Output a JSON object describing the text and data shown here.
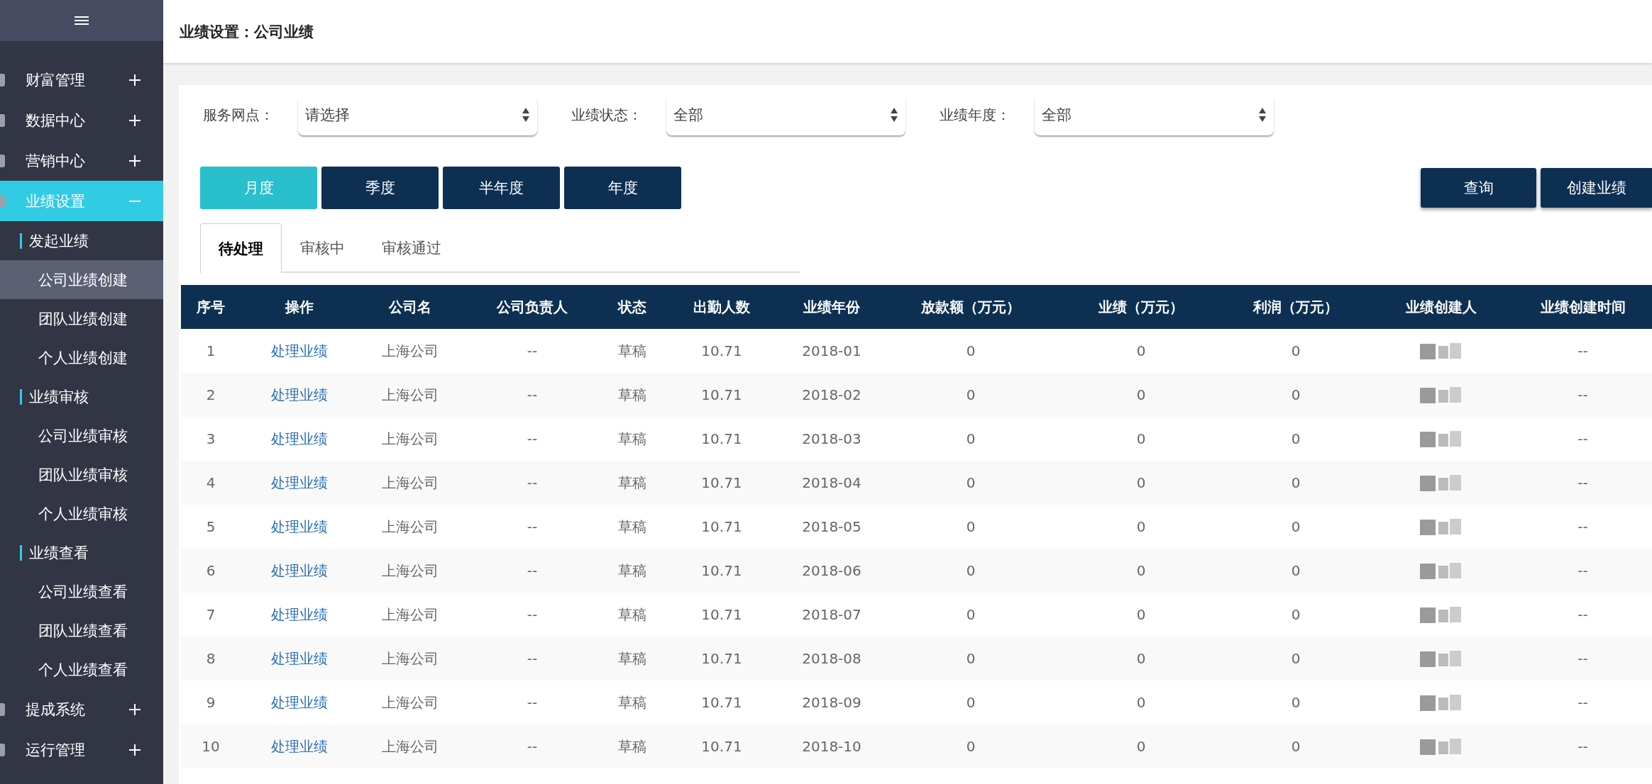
{
  "sidebar": {
    "menu": [
      {
        "label": "财富管理",
        "expanded": false,
        "selected": false
      },
      {
        "label": "数据中心",
        "expanded": false,
        "selected": false
      },
      {
        "label": "营销中心",
        "expanded": false,
        "selected": false
      },
      {
        "label": "业绩设置",
        "expanded": true,
        "selected": true,
        "children": [
          {
            "label": "发起业绩",
            "children": [
              {
                "label": "公司业绩创建",
                "selected": true
              },
              {
                "label": "团队业绩创建",
                "selected": false
              },
              {
                "label": "个人业绩创建",
                "selected": false
              }
            ]
          },
          {
            "label": "业绩审核",
            "children": [
              {
                "label": "公司业绩审核",
                "selected": false
              },
              {
                "label": "团队业绩审核",
                "selected": false
              },
              {
                "label": "个人业绩审核",
                "selected": false
              }
            ]
          },
          {
            "label": "业绩查看",
            "children": [
              {
                "label": "公司业绩查看",
                "selected": false
              },
              {
                "label": "团队业绩查看",
                "selected": false
              },
              {
                "label": "个人业绩查看",
                "selected": false
              }
            ]
          }
        ]
      },
      {
        "label": "提成系统",
        "expanded": false,
        "selected": false
      },
      {
        "label": "运行管理",
        "expanded": false,
        "selected": false
      }
    ]
  },
  "page_title": "业绩设置：公司业绩",
  "filters": [
    {
      "label": "服务网点：",
      "value": "请选择"
    },
    {
      "label": "业绩状态：",
      "value": "全部"
    },
    {
      "label": "业绩年度：",
      "value": "全部"
    }
  ],
  "periods": [
    {
      "label": "月度",
      "selected": true
    },
    {
      "label": "季度",
      "selected": false
    },
    {
      "label": "半年度",
      "selected": false
    },
    {
      "label": "年度",
      "selected": false
    }
  ],
  "actions": [
    "查询",
    "创建业绩"
  ],
  "tabs": [
    {
      "label": "待处理",
      "selected": true
    },
    {
      "label": "审核中",
      "selected": false
    },
    {
      "label": "审核通过",
      "selected": false
    }
  ],
  "table": {
    "columns": [
      "序号",
      "操作",
      "公司名",
      "公司负责人",
      "状态",
      "出勤人数",
      "业绩年份",
      "放款额（万元）",
      "业绩（万元）",
      "利润（万元）",
      "业绩创建人",
      "业绩创建时间"
    ],
    "rows": [
      {
        "index": "1",
        "action": "处理业绩",
        "company": "上海公司",
        "manager": "--",
        "status": "草稿",
        "attendance": "10.71",
        "year": "2018-01",
        "loan": "0",
        "performance": "0",
        "profit": "0",
        "creator_redacted": true,
        "created_at": "--"
      },
      {
        "index": "2",
        "action": "处理业绩",
        "company": "上海公司",
        "manager": "--",
        "status": "草稿",
        "attendance": "10.71",
        "year": "2018-02",
        "loan": "0",
        "performance": "0",
        "profit": "0",
        "creator_redacted": true,
        "created_at": "--"
      },
      {
        "index": "3",
        "action": "处理业绩",
        "company": "上海公司",
        "manager": "--",
        "status": "草稿",
        "attendance": "10.71",
        "year": "2018-03",
        "loan": "0",
        "performance": "0",
        "profit": "0",
        "creator_redacted": true,
        "created_at": "--"
      },
      {
        "index": "4",
        "action": "处理业绩",
        "company": "上海公司",
        "manager": "--",
        "status": "草稿",
        "attendance": "10.71",
        "year": "2018-04",
        "loan": "0",
        "performance": "0",
        "profit": "0",
        "creator_redacted": true,
        "created_at": "--"
      },
      {
        "index": "5",
        "action": "处理业绩",
        "company": "上海公司",
        "manager": "--",
        "status": "草稿",
        "attendance": "10.71",
        "year": "2018-05",
        "loan": "0",
        "performance": "0",
        "profit": "0",
        "creator_redacted": true,
        "created_at": "--"
      },
      {
        "index": "6",
        "action": "处理业绩",
        "company": "上海公司",
        "manager": "--",
        "status": "草稿",
        "attendance": "10.71",
        "year": "2018-06",
        "loan": "0",
        "performance": "0",
        "profit": "0",
        "creator_redacted": true,
        "created_at": "--"
      },
      {
        "index": "7",
        "action": "处理业绩",
        "company": "上海公司",
        "manager": "--",
        "status": "草稿",
        "attendance": "10.71",
        "year": "2018-07",
        "loan": "0",
        "performance": "0",
        "profit": "0",
        "creator_redacted": true,
        "created_at": "--"
      },
      {
        "index": "8",
        "action": "处理业绩",
        "company": "上海公司",
        "manager": "--",
        "status": "草稿",
        "attendance": "10.71",
        "year": "2018-08",
        "loan": "0",
        "performance": "0",
        "profit": "0",
        "creator_redacted": true,
        "created_at": "--"
      },
      {
        "index": "9",
        "action": "处理业绩",
        "company": "上海公司",
        "manager": "--",
        "status": "草稿",
        "attendance": "10.71",
        "year": "2018-09",
        "loan": "0",
        "performance": "0",
        "profit": "0",
        "creator_redacted": true,
        "created_at": "--"
      },
      {
        "index": "10",
        "action": "处理业绩",
        "company": "上海公司",
        "manager": "--",
        "status": "草稿",
        "attendance": "10.71",
        "year": "2018-10",
        "loan": "0",
        "performance": "0",
        "profit": "0",
        "creator_redacted": true,
        "created_at": "--"
      }
    ]
  }
}
